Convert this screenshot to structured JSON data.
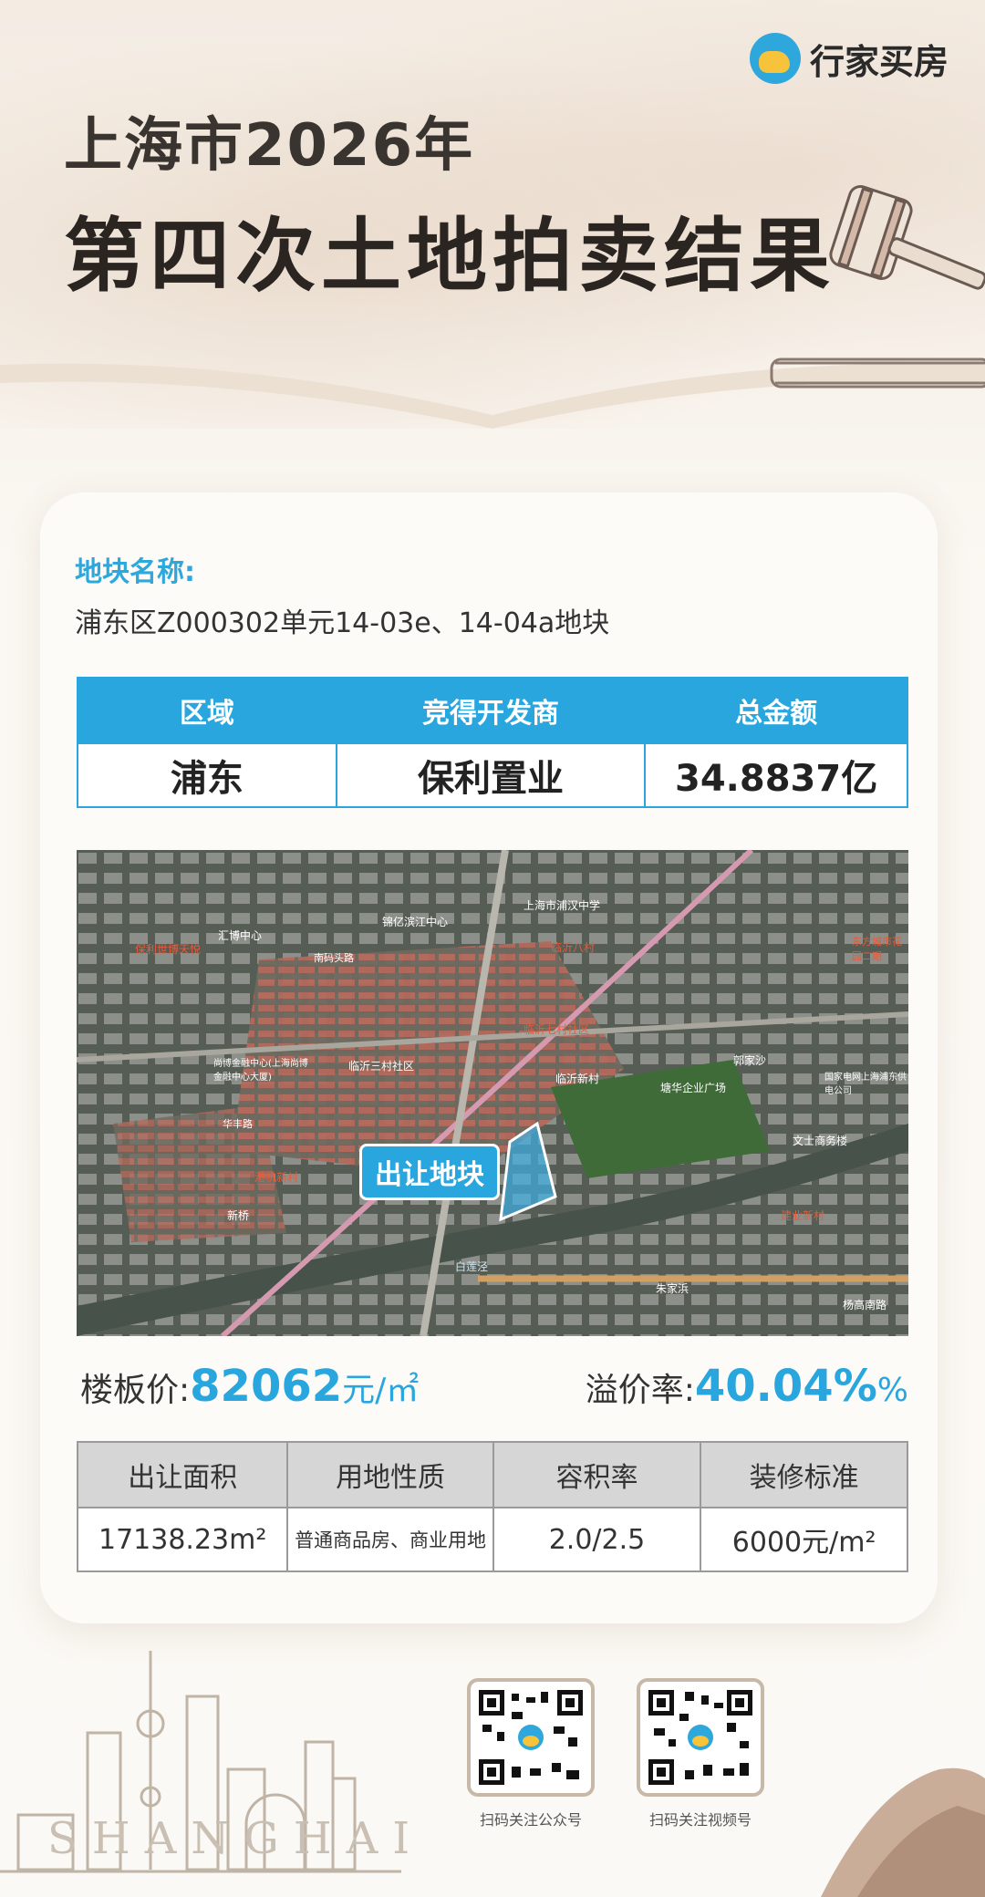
{
  "brand": {
    "name": "行家买房"
  },
  "header": {
    "title_line1": "上海市2026年",
    "title_line2": "第四次土地拍卖结果"
  },
  "plot": {
    "label": "地块名称:",
    "name": "浦东区Z000302单元14-03e、14-04a地块"
  },
  "summary_table": {
    "headers": [
      "区域",
      "竞得开发商",
      "总金额"
    ],
    "values": [
      "浦东",
      "保利置业",
      "34.8837亿"
    ]
  },
  "map": {
    "callout": "出让地块",
    "labels": [
      "上海市浦汉中学",
      "锦亿滨江中心",
      "临沂八村",
      "汇博中心",
      "保利世博天悦",
      "南码头路",
      "临沂七村社区",
      "临沂三村社区",
      "尚博金融中心(上海尚博金融中心大厦)",
      "临沂新村",
      "塘华企业广场",
      "郭家沙",
      "东方城市花园二期",
      "国家电网上海浦东供电公司",
      "华丰路",
      "文士商务楼",
      "港机新村",
      "新桥",
      "建业新村",
      "杨高南路",
      "朱家浜",
      "白莲泾"
    ]
  },
  "price": {
    "floor_label": "楼板价:",
    "floor_value": "82062",
    "floor_unit": "元/㎡",
    "premium_label": "溢价率:",
    "premium_value": "40.04%",
    "premium_unit": "%"
  },
  "detail_table": {
    "headers": [
      "出让面积",
      "用地性质",
      "容积率",
      "装修标准"
    ],
    "values": [
      "17138.23m²",
      "普通商品房、商业用地",
      "2.0/2.5",
      "6000元/m²"
    ]
  },
  "footer": {
    "city": "SHANGHAI",
    "qr1_label": "扫码关注公众号",
    "qr2_label": "扫码关注视频号"
  },
  "colors": {
    "accent": "#2aa6de",
    "title": "#2b2522",
    "table_header_gray": "#d6d6d6"
  }
}
